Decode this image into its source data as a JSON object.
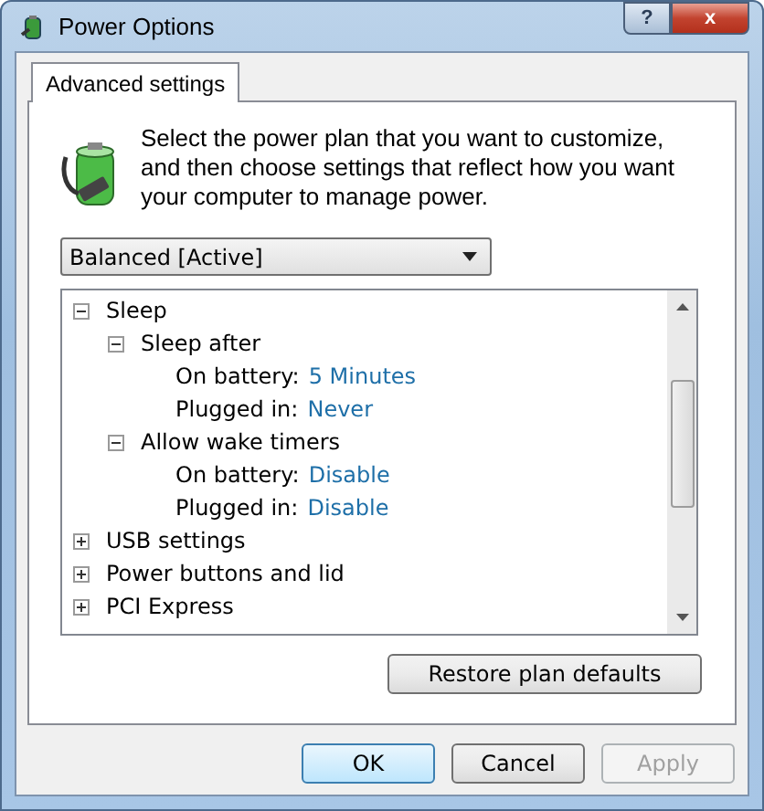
{
  "window": {
    "title": "Power Options",
    "help_button": "?",
    "close_button": "x"
  },
  "tabs": [
    {
      "label": "Advanced settings",
      "selected": true
    }
  ],
  "intro": "Select the power plan that you want to customize, and then choose settings that reflect how you want your computer to manage power.",
  "plan_dropdown": {
    "value": "Balanced [Active]"
  },
  "tree": [
    {
      "kind": "group",
      "label": "Sleep",
      "expanded": true,
      "children": [
        {
          "kind": "group",
          "label": "Sleep after",
          "expanded": true,
          "children": [
            {
              "kind": "setting",
              "label": "On battery:",
              "value": "5 Minutes"
            },
            {
              "kind": "setting",
              "label": "Plugged in:",
              "value": "Never"
            }
          ]
        },
        {
          "kind": "group",
          "label": "Allow wake timers",
          "expanded": true,
          "children": [
            {
              "kind": "setting",
              "label": "On battery:",
              "value": "Disable"
            },
            {
              "kind": "setting",
              "label": "Plugged in:",
              "value": "Disable"
            }
          ]
        }
      ]
    },
    {
      "kind": "group",
      "label": "USB settings",
      "expanded": false
    },
    {
      "kind": "group",
      "label": "Power buttons and lid",
      "expanded": false
    },
    {
      "kind": "group",
      "label": "PCI Express",
      "expanded": false
    }
  ],
  "restore_button": "Restore plan defaults",
  "buttons": [
    {
      "label": "OK",
      "disabled": false,
      "default": true
    },
    {
      "label": "Cancel",
      "disabled": false,
      "default": false
    },
    {
      "label": "Apply",
      "disabled": true,
      "default": false
    }
  ]
}
